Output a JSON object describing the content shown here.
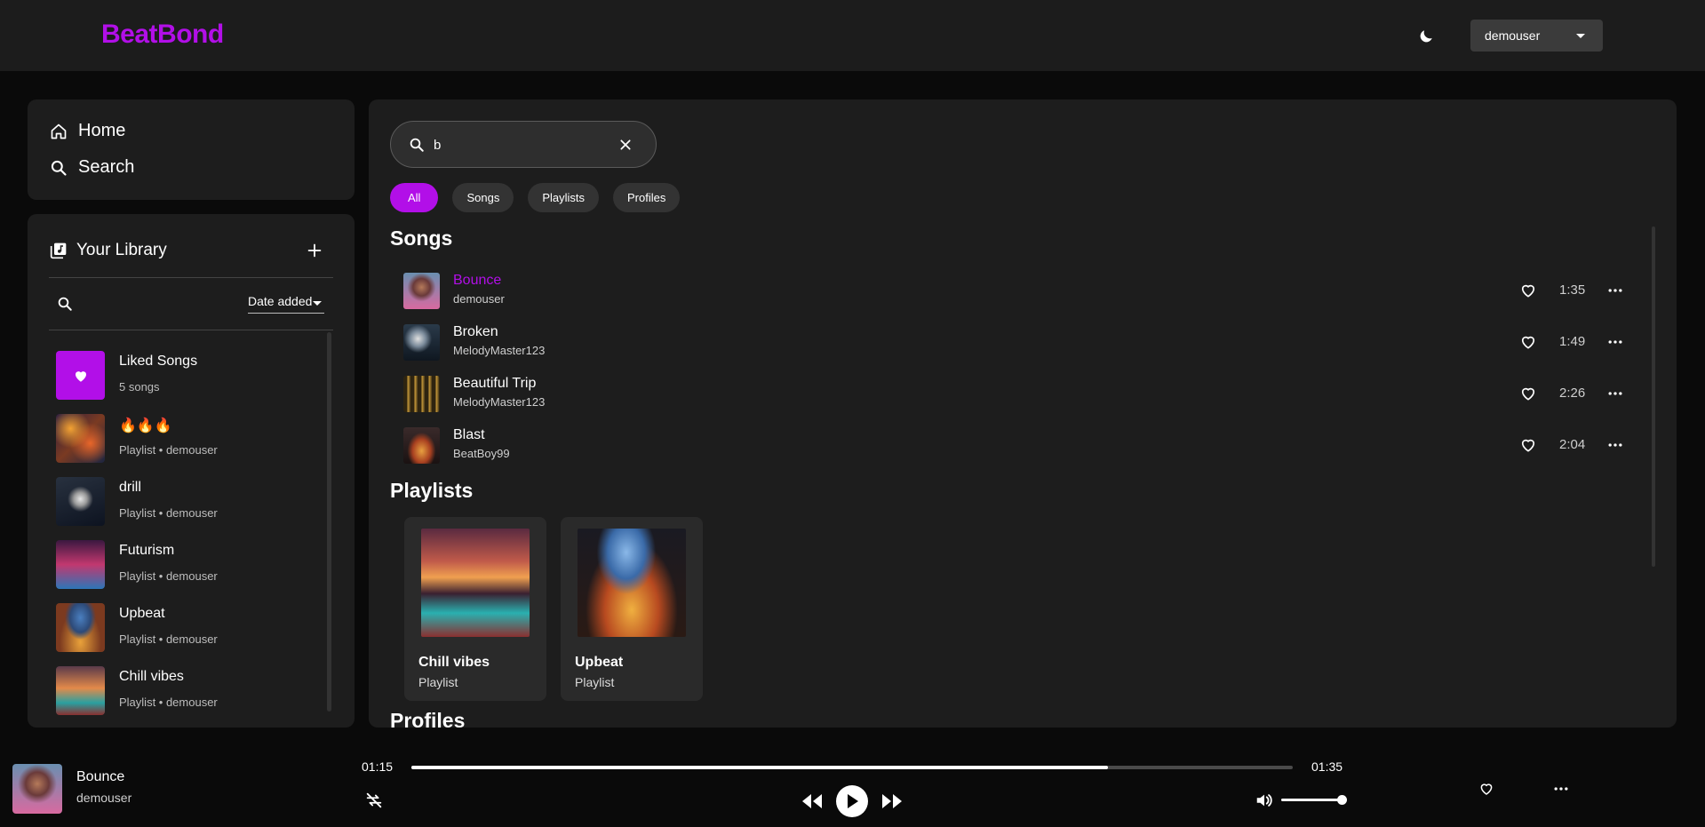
{
  "app": {
    "logo": "BeatBond",
    "accent": "#b20fe8"
  },
  "header": {
    "theme_icon": "moon-icon",
    "user": "demouser"
  },
  "nav": {
    "home": "Home",
    "search": "Search"
  },
  "library": {
    "title": "Your Library",
    "sort": "Date added",
    "items": [
      {
        "title": "Liked Songs",
        "subtitle": "5 songs"
      },
      {
        "title": "🔥🔥🔥",
        "subtitle": "Playlist • demouser"
      },
      {
        "title": "drill",
        "subtitle": "Playlist • demouser"
      },
      {
        "title": "Futurism",
        "subtitle": "Playlist • demouser"
      },
      {
        "title": "Upbeat",
        "subtitle": "Playlist • demouser"
      },
      {
        "title": "Chill vibes",
        "subtitle": "Playlist • demouser"
      }
    ]
  },
  "search": {
    "value": "b",
    "filters": [
      "All",
      "Songs",
      "Playlists",
      "Profiles"
    ],
    "active_filter": "All"
  },
  "results": {
    "songs_heading": "Songs",
    "songs": [
      {
        "title": "Bounce",
        "artist": "demouser",
        "duration": "1:35",
        "playing": true
      },
      {
        "title": "Broken",
        "artist": "MelodyMaster123",
        "duration": "1:49"
      },
      {
        "title": "Beautiful Trip",
        "artist": "MelodyMaster123",
        "duration": "2:26"
      },
      {
        "title": "Blast",
        "artist": "BeatBoy99",
        "duration": "2:04"
      }
    ],
    "playlists_heading": "Playlists",
    "playlists": [
      {
        "title": "Chill vibes",
        "type": "Playlist"
      },
      {
        "title": "Upbeat",
        "type": "Playlist"
      }
    ],
    "profiles_heading": "Profiles"
  },
  "player": {
    "title": "Bounce",
    "artist": "demouser",
    "current_time": "01:15",
    "total_time": "01:35",
    "progress": 0.79,
    "volume": 0.9
  }
}
